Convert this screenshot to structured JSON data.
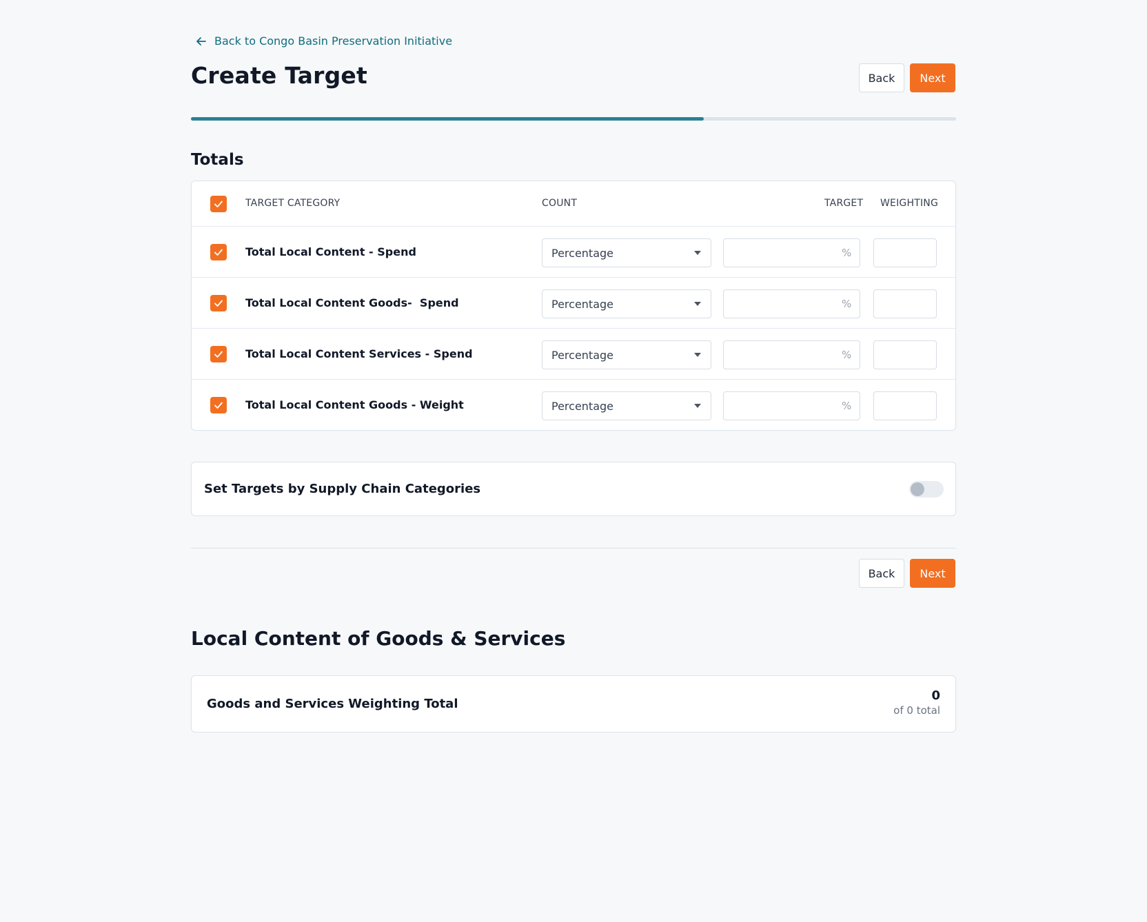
{
  "nav": {
    "back_link_label": "Back to Congo Basin Preservation Initiative"
  },
  "header": {
    "title": "Create Target",
    "back_label": "Back",
    "next_label": "Next"
  },
  "progress": {
    "fraction": 0.67
  },
  "totals": {
    "title": "Totals",
    "columns": {
      "category": "TARGET CATEGORY",
      "count": "COUNT",
      "target": "TARGET",
      "weighting": "WEIGHTING"
    },
    "rows": [
      {
        "label": "Total Local Content - Spend",
        "count": "Percentage",
        "target_unit": "%",
        "checked": true
      },
      {
        "label": "Total Local Content Goods-  Spend",
        "count": "Percentage",
        "target_unit": "%",
        "checked": true
      },
      {
        "label": "Total Local Content Services - Spend",
        "count": "Percentage",
        "target_unit": "%",
        "checked": true
      },
      {
        "label": "Total Local Content Goods - Weight",
        "count": "Percentage",
        "target_unit": "%",
        "checked": true
      }
    ]
  },
  "supply_chain": {
    "label": "Set Targets by Supply Chain Categories",
    "enabled": false
  },
  "footer": {
    "back_label": "Back",
    "next_label": "Next"
  },
  "local_content": {
    "title": "Local Content of Goods & Services",
    "summary_label": "Goods and Services Weighting Total",
    "summary_value": "0",
    "summary_sub": "of 0 total"
  },
  "colors": {
    "accent": "#f26f21",
    "progress": "#2a8196",
    "link": "#136c7e"
  }
}
